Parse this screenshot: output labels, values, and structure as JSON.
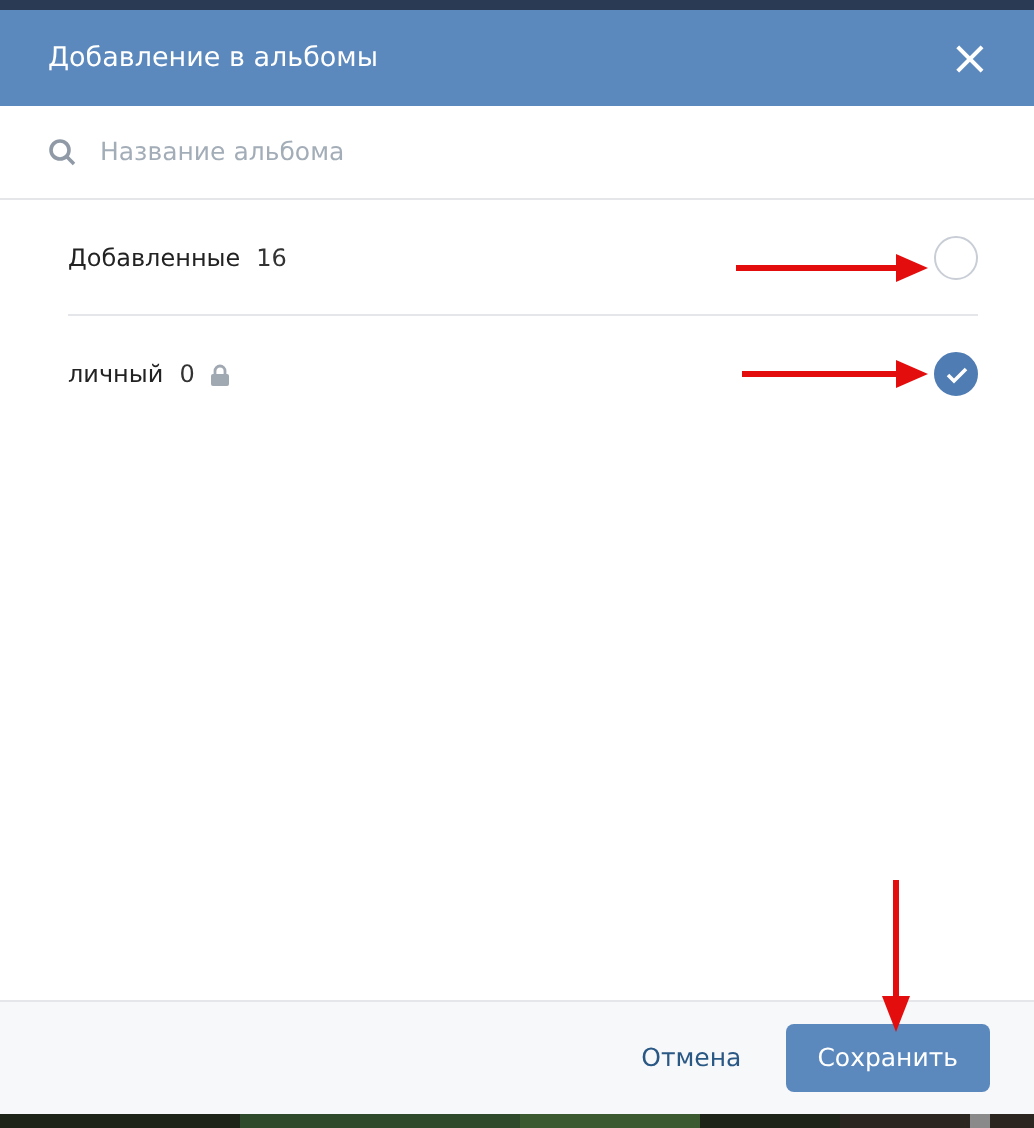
{
  "window": {
    "title": "Добавление в альбомы",
    "close": "×"
  },
  "search": {
    "placeholder": "Название альбома"
  },
  "albums": [
    {
      "name": "Добавленные",
      "count": "16",
      "locked": false,
      "selected": false
    },
    {
      "name": "личный",
      "count": "0",
      "locked": true,
      "selected": true
    }
  ],
  "buttons": [
    {
      "label": "Отмена",
      "kind": "link"
    },
    {
      "label": "Сохранить",
      "kind": "primary"
    }
  ]
}
